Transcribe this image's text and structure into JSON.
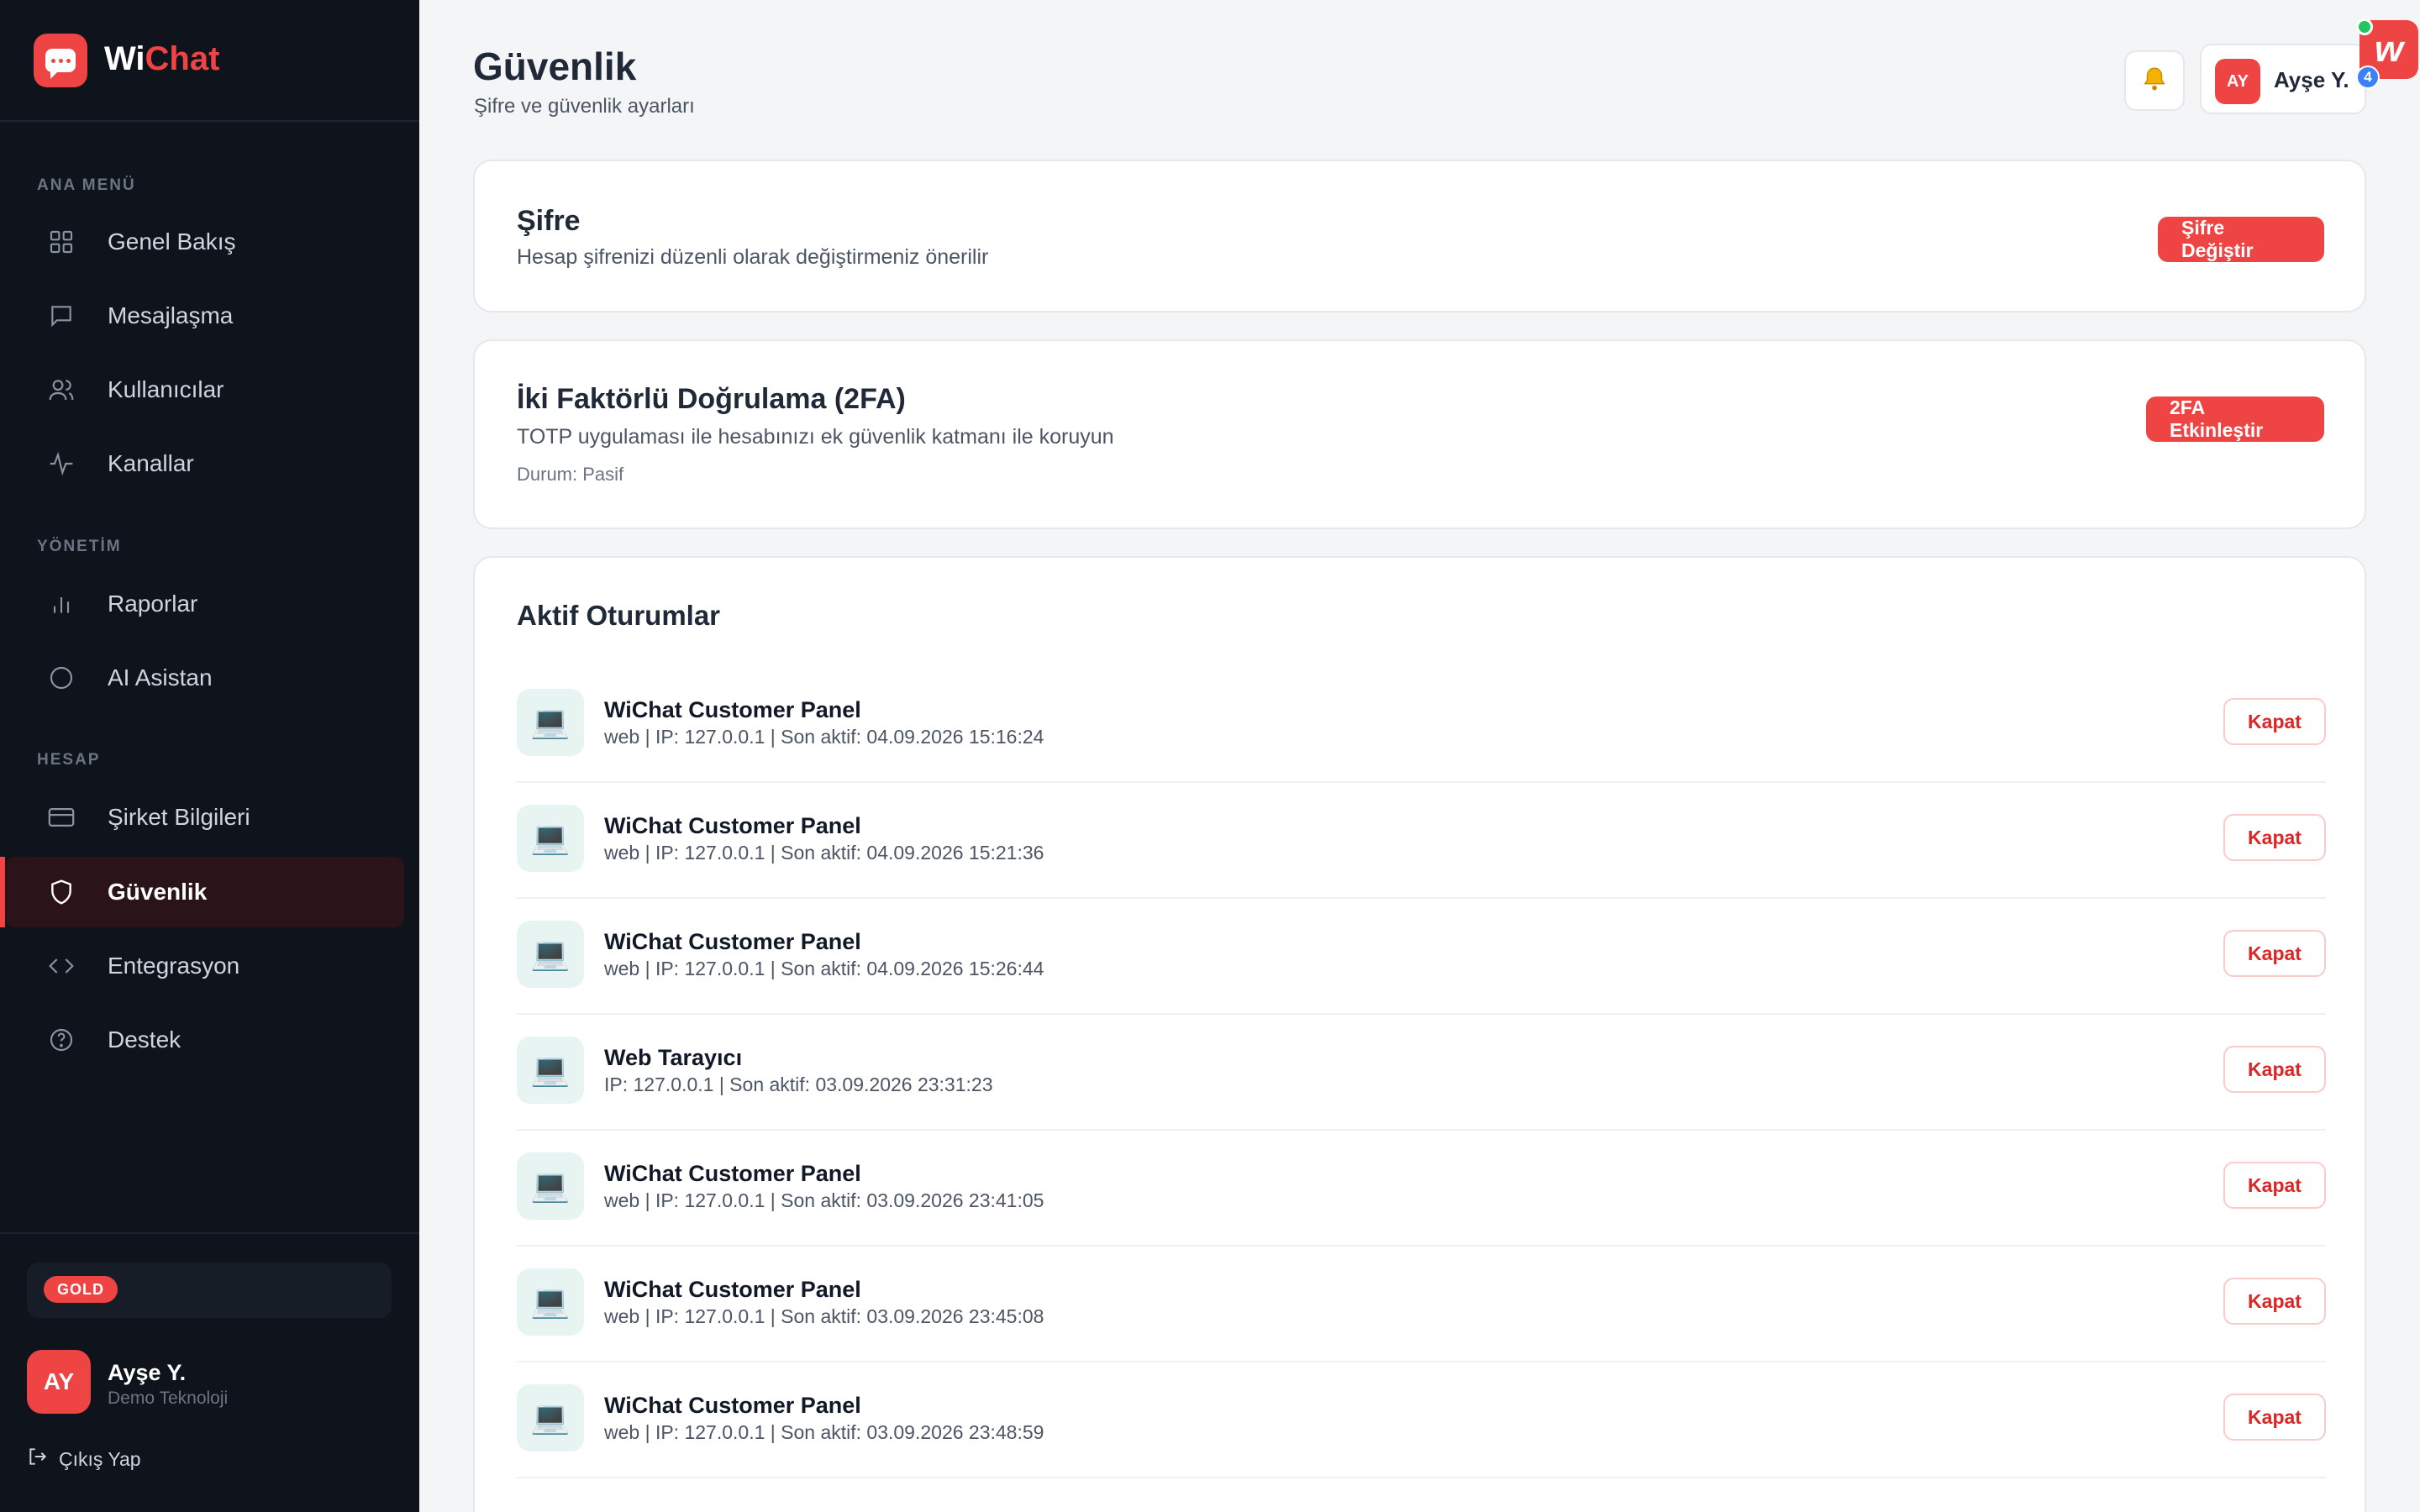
{
  "brand": {
    "name_part1": "Wi",
    "name_part2": "Chat"
  },
  "sidebar": {
    "sections": {
      "main": "ANA MENÜ",
      "management": "YÖNETİM",
      "account": "HESAP"
    },
    "items": [
      {
        "label": "Genel Bakış",
        "icon": "grid-icon"
      },
      {
        "label": "Mesajlaşma",
        "icon": "message-icon"
      },
      {
        "label": "Kullanıcılar",
        "icon": "users-icon"
      },
      {
        "label": "Kanallar",
        "icon": "activity-icon"
      },
      {
        "label": "Raporlar",
        "icon": "bar-chart-icon"
      },
      {
        "label": "AI Asistan",
        "icon": "circle-icon"
      },
      {
        "label": "Şirket Bilgileri",
        "icon": "card-icon"
      },
      {
        "label": "Güvenlik",
        "icon": "shield-icon",
        "active": true
      },
      {
        "label": "Entegrasyon",
        "icon": "code-icon"
      },
      {
        "label": "Destek",
        "icon": "help-icon"
      }
    ],
    "plan_badge": "GOLD",
    "user": {
      "initials": "AY",
      "name": "Ayşe Y.",
      "company": "Demo Teknoloji"
    },
    "logout_label": "Çıkış Yap"
  },
  "header": {
    "title": "Güvenlik",
    "subtitle": "Şifre ve güvenlik ayarları",
    "profile": {
      "initials": "AY",
      "name": "Ayşe Y."
    },
    "notification_count": "4"
  },
  "password_card": {
    "title": "Şifre",
    "description": "Hesap şifrenizi düzenli olarak değiştirmeniz önerilir",
    "button": "Şifre Değiştir"
  },
  "twofa_card": {
    "title": "İki Faktörlü Doğrulama (2FA)",
    "description": "TOTP uygulaması ile hesabınızı ek güvenlik katmanı ile koruyun",
    "status": "Durum: Pasif",
    "button": "2FA Etkinleştir"
  },
  "sessions_card": {
    "title": "Aktif Oturumlar",
    "close_label": "Kapat",
    "sessions": [
      {
        "name": "WiChat Customer Panel",
        "meta": "web | IP: 127.0.0.1 | Son aktif: 04.09.2026 15:16:24"
      },
      {
        "name": "WiChat Customer Panel",
        "meta": "web | IP: 127.0.0.1 | Son aktif: 04.09.2026 15:21:36"
      },
      {
        "name": "WiChat Customer Panel",
        "meta": "web | IP: 127.0.0.1 | Son aktif: 04.09.2026 15:26:44"
      },
      {
        "name": "Web Tarayıcı",
        "meta": "IP: 127.0.0.1 | Son aktif: 03.09.2026 23:31:23"
      },
      {
        "name": "WiChat Customer Panel",
        "meta": "web | IP: 127.0.0.1 | Son aktif: 03.09.2026 23:41:05"
      },
      {
        "name": "WiChat Customer Panel",
        "meta": "web | IP: 127.0.0.1 | Son aktif: 03.09.2026 23:45:08"
      },
      {
        "name": "WiChat Customer Panel",
        "meta": "web | IP: 127.0.0.1 | Son aktif: 03.09.2026 23:48:59"
      }
    ]
  },
  "colors": {
    "accent": "#ef4444",
    "sidebar_bg": "#0f141c",
    "page_bg": "#f4f5f7"
  }
}
